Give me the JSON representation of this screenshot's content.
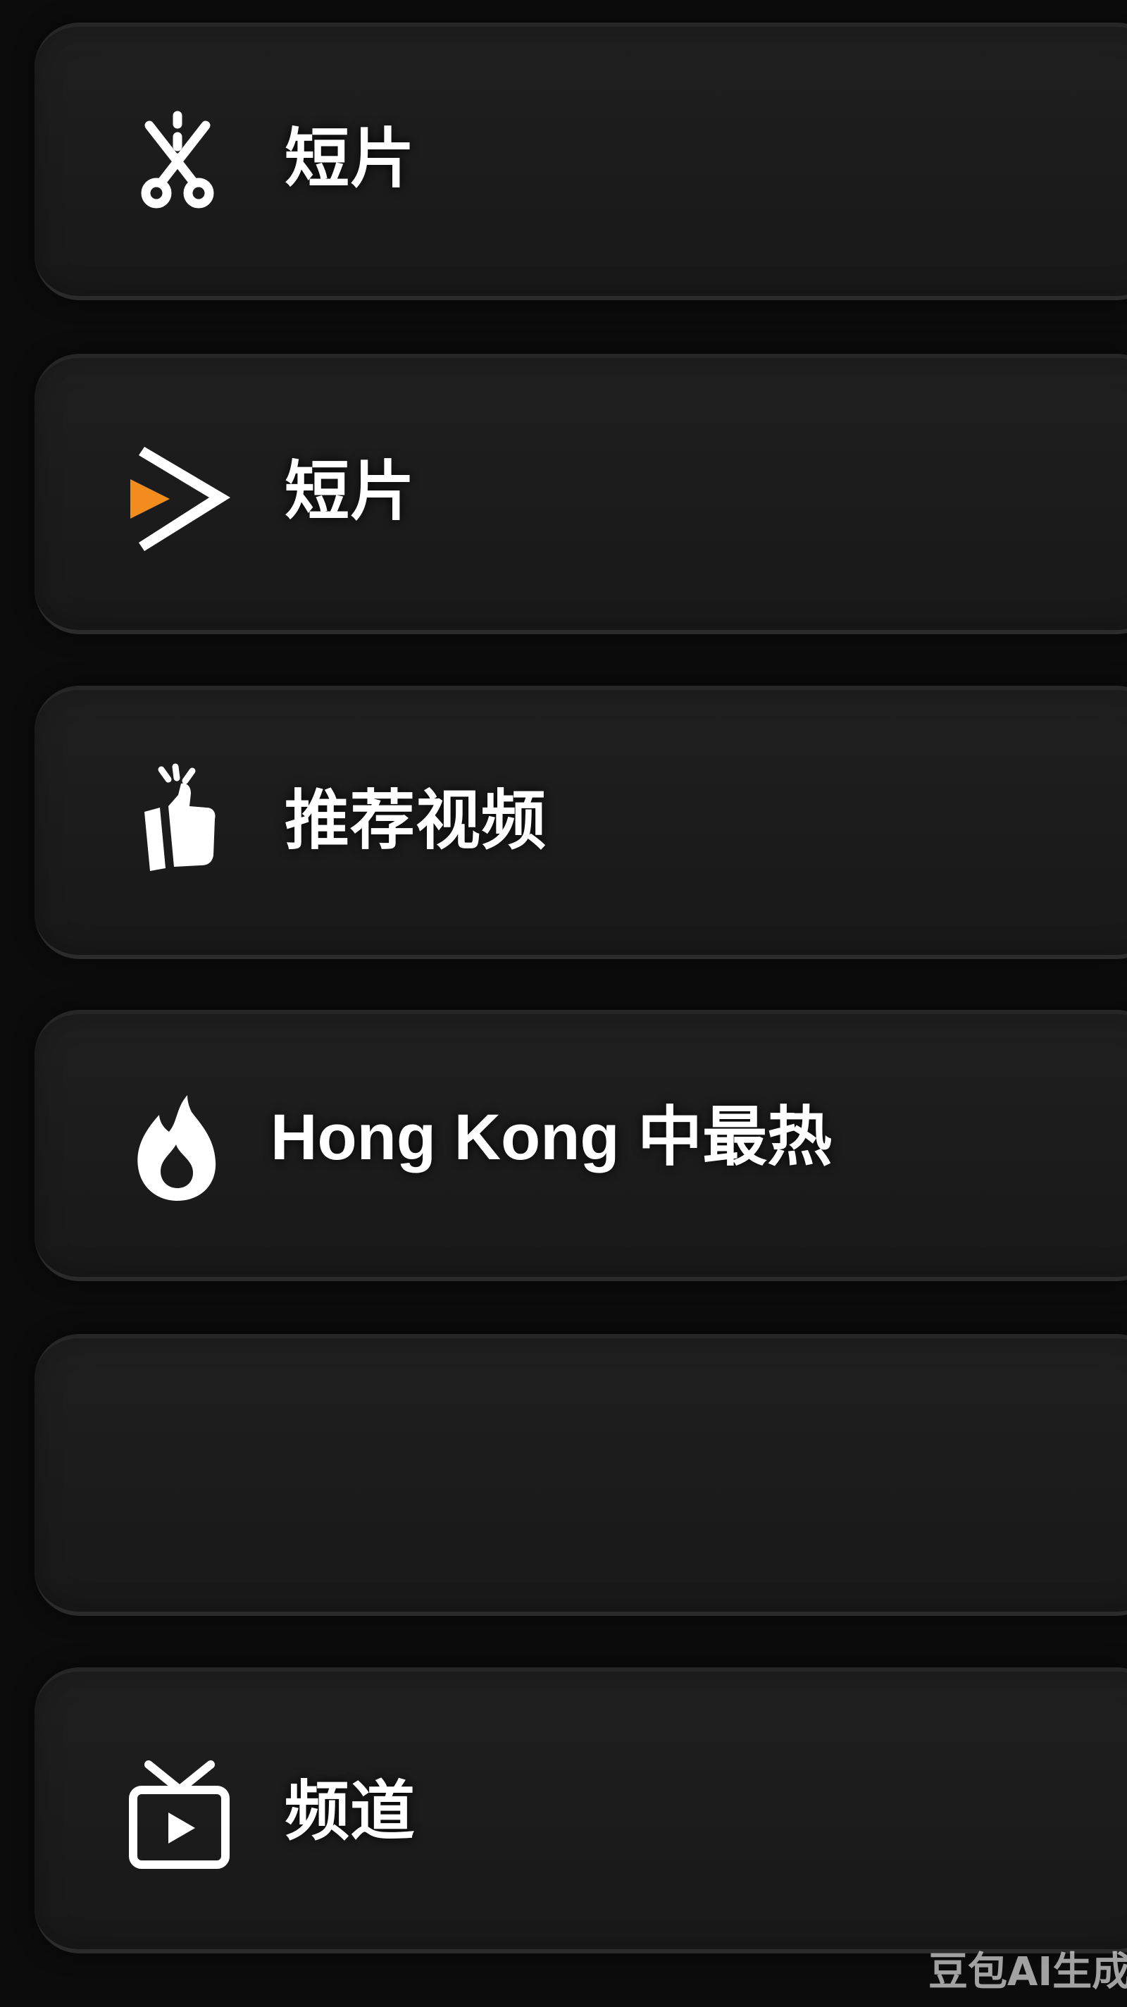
{
  "menu": {
    "items": [
      {
        "label": "短片",
        "icon": "scissors-icon"
      },
      {
        "label": "短片",
        "icon": "play-arrow-icon"
      },
      {
        "label": "推荐视频",
        "icon": "thumbs-up-icon"
      },
      {
        "label": "Hong Kong 中最热",
        "icon": "flame-icon"
      },
      {
        "label": "",
        "icon": ""
      },
      {
        "label": "频道",
        "icon": "tv-icon"
      }
    ]
  },
  "watermark": {
    "text": "豆包AI生成"
  },
  "colors": {
    "background": "#0c0c0c",
    "card": "#1c1c1c",
    "text": "#ffffff",
    "accent": "#f28c1e"
  }
}
